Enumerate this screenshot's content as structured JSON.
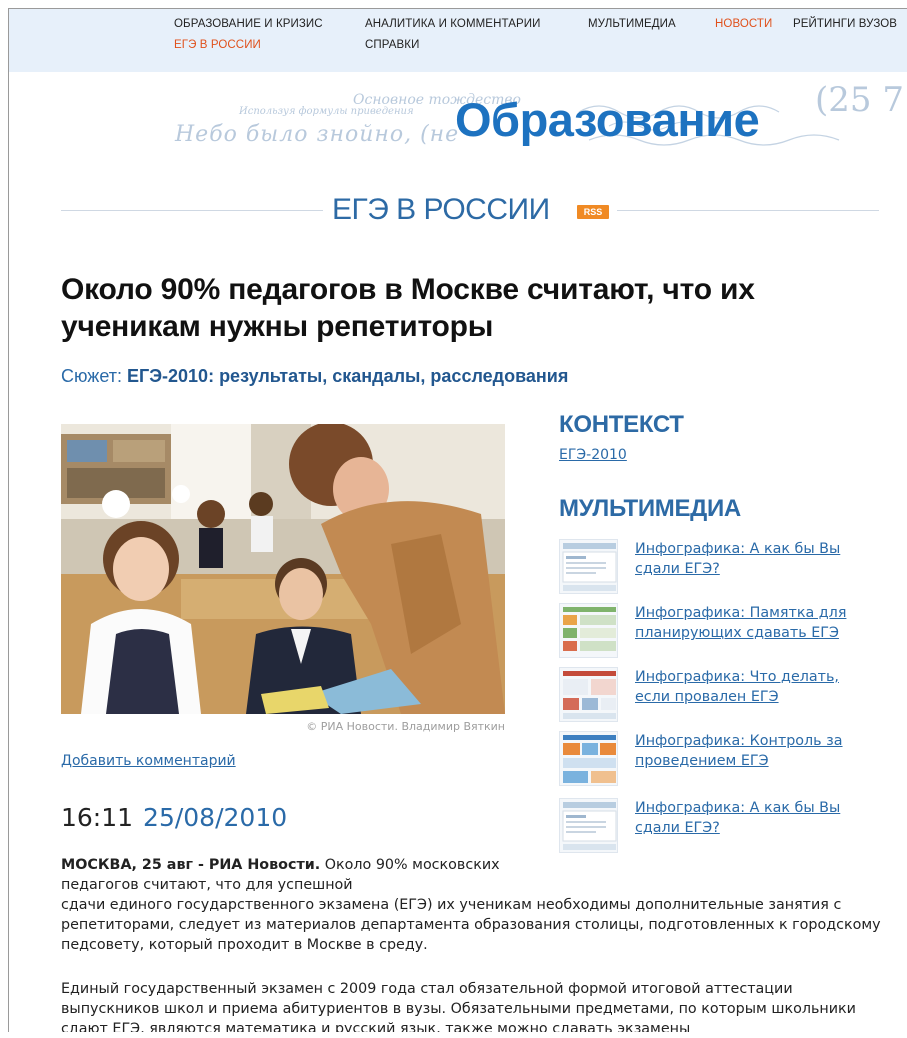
{
  "topnav": {
    "items": [
      {
        "label": "ОБРАЗОВАНИЕ И КРИЗИС"
      },
      {
        "label": "АНАЛИТИКА И КОММЕНТАРИИ"
      },
      {
        "label": "МУЛЬТИМЕДИА"
      },
      {
        "label": "НОВОСТИ"
      },
      {
        "label": "РЕЙТИНГИ ВУЗОВ"
      },
      {
        "label": "ЕГЭ В РОССИИ"
      },
      {
        "label": "СПРАВКИ"
      }
    ],
    "active_color": "#e0511c"
  },
  "header": {
    "logo": "Образование",
    "handwriting": {
      "line1": "Основное тождество",
      "line2": "Небо было знойно, (не",
      "line3": "Используя формулы приведения",
      "formula": "(25 7"
    }
  },
  "section": {
    "title": "ЕГЭ В РОССИИ",
    "rss_label": "RSS"
  },
  "article": {
    "headline": "Около 90% педагогов в Москве считают, что их ученикам нужны репетиторы",
    "story_prefix": "Сюжет:",
    "story_link": "ЕГЭ-2010: результаты, скандалы, расследования",
    "photo_credit": "© РИА Новости. Владимир Вяткин",
    "add_comment": "Добавить комментарий",
    "time": "16:11",
    "date": "25/08/2010",
    "dateline": "МОСКВА, 25 авг - РИА Новости.",
    "p1_start": "Около 90% московских педагогов считают, что для успешной",
    "p1_rest": "сдачи единого государственного экзамена (ЕГЭ) их ученикам необходимы дополнительные занятия с репетиторами, следует из материалов департамента образования столицы, подготовленных к городскому педсовету, который проходит в Москве в среду.",
    "p2": "Единый государственный экзамен с 2009 года стал обязательной формой итоговой аттестации выпускников школ и приема абитуриентов в вузы. Обязательными предметами, по которым школьники сдают ЕГЭ, являются математика и русский язык, также можно сдавать экзамены"
  },
  "sidebar": {
    "context_title": "КОНТЕКСТ",
    "context_link": "ЕГЭ-2010",
    "multimedia_title": "МУЛЬТИМЕДИА",
    "multimedia": [
      {
        "title": "Инфографика: А как бы Вы сдали ЕГЭ?"
      },
      {
        "title": "Инфографика: Памятка для планирующих сдавать ЕГЭ"
      },
      {
        "title": "Инфографика: Что делать, если провален ЕГЭ"
      },
      {
        "title": "Инфографика: Контроль за проведением ЕГЭ"
      },
      {
        "title": "Инфографика: А как бы Вы сдали ЕГЭ?"
      }
    ]
  },
  "colors": {
    "nav_bg": "#e7f0fa",
    "link": "#2a6aa8",
    "logo": "#1d72c0",
    "rss": "#f08a24"
  }
}
